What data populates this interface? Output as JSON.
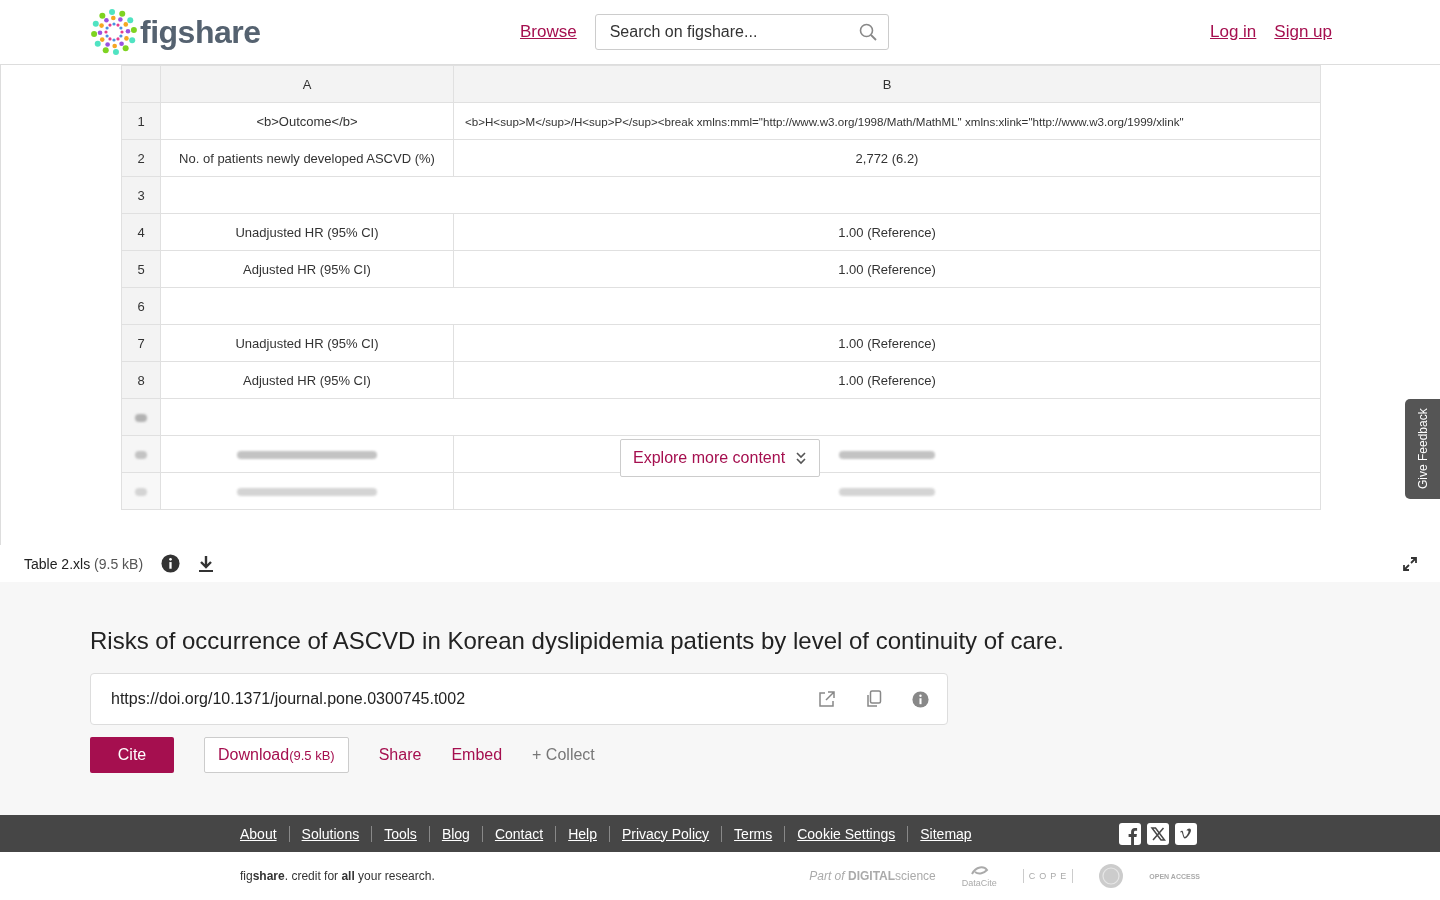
{
  "header": {
    "logo": "figshare",
    "nav": [
      "Browse"
    ],
    "search": {
      "placeholder": "Search on figshare..."
    },
    "auth": [
      "Log in",
      "Sign up"
    ]
  },
  "viewer": {
    "columns": [
      "A",
      "B"
    ],
    "rows": [
      {
        "kind": "data",
        "number": "1",
        "cells": [
          "<b>Outcome</b>",
          "<b>H<sup>M</sup>/H<sup>P</sup><break xmlns:mml=\"http://www.w3.org/1998/Math/MathML\" xmlns:xlink=\"http://www.w3.org/1999/xlink\""
        ]
      },
      {
        "kind": "data",
        "number": "2",
        "cells": [
          "No. of patients newly developed ASCVD (%)",
          "2,772 (6.2)"
        ]
      },
      {
        "kind": "data",
        "number": "3"
      },
      {
        "kind": "data",
        "number": "4",
        "cells": [
          "Unadjusted HR (95% CI)",
          "1.00 (Reference)"
        ]
      },
      {
        "kind": "data",
        "number": "5",
        "cells": [
          "Adjusted HR (95% CI)",
          "1.00 (Reference)"
        ]
      },
      {
        "kind": "data",
        "number": "6"
      },
      {
        "kind": "data",
        "number": "7",
        "cells": [
          "Unadjusted HR (95% CI)",
          "1.00 (Reference)"
        ]
      },
      {
        "kind": "data",
        "number": "8",
        "cells": [
          "Adjusted HR (95% CI)",
          "1.00 (Reference)"
        ]
      },
      {
        "kind": "faded-empty"
      },
      {
        "kind": "faded"
      },
      {
        "kind": "faded"
      }
    ],
    "explore_button": "Explore more content",
    "feedback_tab": "Give Feedback",
    "file": {
      "name": "Table 2.xls",
      "size": "(9.5 kB)"
    }
  },
  "item": {
    "title": "Risks of occurrence of ASCVD in Korean dyslipidemia patients by level of continuity of care.",
    "doi": "https://doi.org/10.1371/journal.pone.0300745.t002",
    "actions": [
      {
        "kind": "primary",
        "label": "Cite"
      },
      {
        "kind": "outlined",
        "label": "Download",
        "note": "(9.5 kB)"
      },
      {
        "kind": "link",
        "label": "Share"
      },
      {
        "kind": "link",
        "label": "Embed"
      },
      {
        "kind": "muted",
        "label": "+ Collect"
      }
    ]
  },
  "footer": {
    "links": [
      "About",
      "Solutions",
      "Tools",
      "Blog",
      "Contact",
      "Help",
      "Privacy Policy",
      "Terms",
      "Cookie Settings",
      "Sitemap"
    ],
    "tagline": "fig**share**. credit for **all** your research.",
    "partners": [
      {
        "kind": "digital-science",
        "text": "*Part of* **DIGITAL**science"
      },
      {
        "kind": "datacite",
        "text": "DataCite"
      },
      {
        "kind": "cope",
        "text": "COPE"
      },
      {
        "kind": "seal"
      },
      {
        "kind": "open-access",
        "text": "OPEN ACCESS"
      }
    ]
  }
}
